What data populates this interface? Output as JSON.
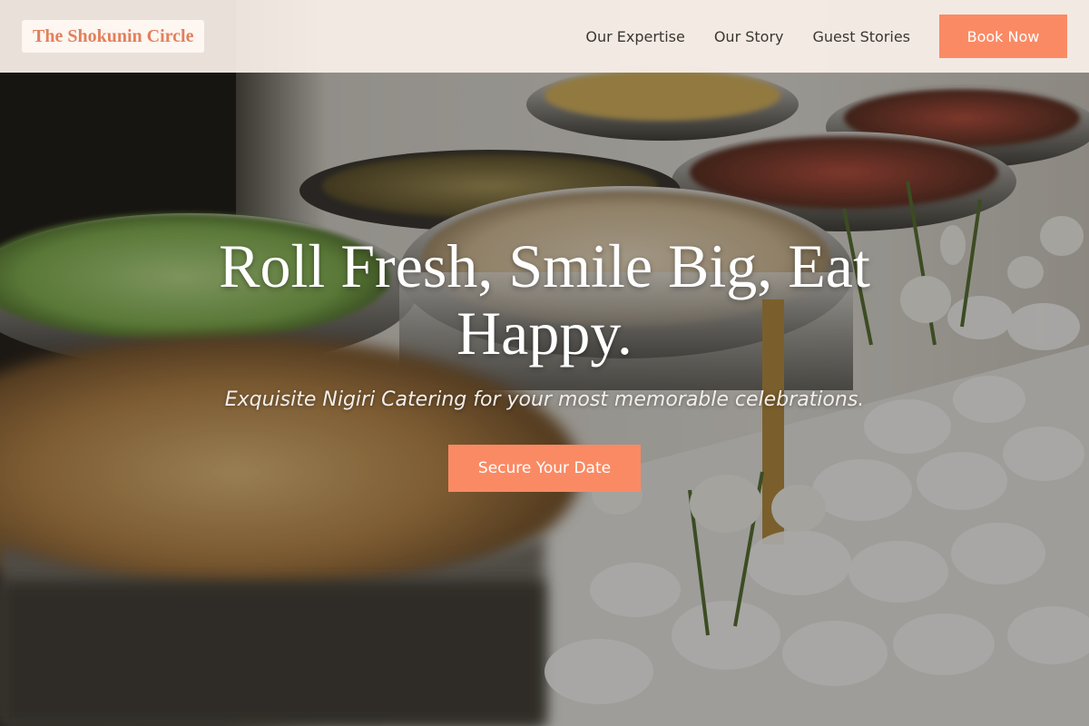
{
  "header": {
    "brand": "The Shokunin Circle",
    "nav": [
      {
        "label": "Our Expertise"
      },
      {
        "label": "Our Story"
      },
      {
        "label": "Guest Stories"
      }
    ],
    "book_label": "Book Now"
  },
  "hero": {
    "title": "Roll Fresh, Smile Big, Eat Happy.",
    "subtitle": "Exquisite Nigiri Catering for your most memorable celebrations.",
    "cta_label": "Secure Your Date",
    "background_image": "catering-buffet-photo"
  },
  "colors": {
    "accent": "#fa8a64",
    "brand_text": "#e2805c",
    "header_bg": "#faf0ea",
    "nav_text": "#3b3631"
  }
}
